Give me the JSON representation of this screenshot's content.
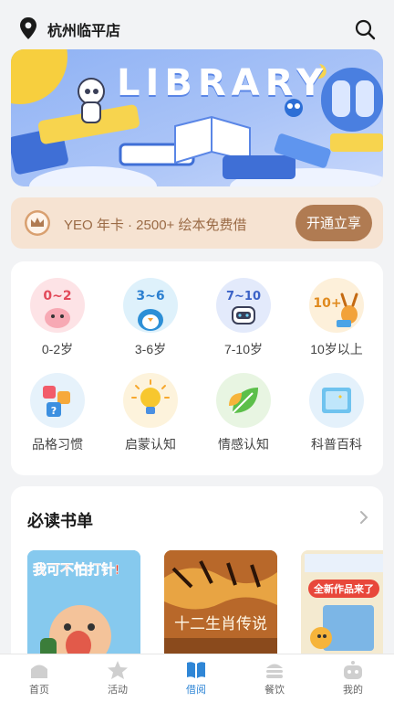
{
  "header": {
    "store_name": "杭州临平店"
  },
  "banner": {
    "title": "LIBRARY"
  },
  "vip": {
    "text": "YEO 年卡 · 2500+ 绘本免费借",
    "button": "开通立享"
  },
  "categories": [
    {
      "label": "0-2岁",
      "badge": "0~2",
      "color": "#fde3e6"
    },
    {
      "label": "3-6岁",
      "badge": "3~6",
      "color": "#def1fb"
    },
    {
      "label": "7-10岁",
      "badge": "7~10",
      "color": "#e3eafb"
    },
    {
      "label": "10岁以上",
      "badge": "10+",
      "color": "#fdf0da"
    },
    {
      "label": "品格习惯",
      "icon": "puzzle-icon",
      "color": "#e6f2fb"
    },
    {
      "label": "启蒙认知",
      "icon": "lightbulb-icon",
      "color": "#fdf3dc"
    },
    {
      "label": "情感认知",
      "icon": "leaf-icon",
      "color": "#e8f5e2"
    },
    {
      "label": "科普百科",
      "icon": "book-icon",
      "color": "#e4f1fb"
    }
  ],
  "reading_list": {
    "title": "必读书单",
    "books": [
      {
        "title": "我可不怕打针!",
        "color": "#7fc4ea"
      },
      {
        "title": "十二生肖传说",
        "color": "#c0722c"
      },
      {
        "title": "全新作品来了",
        "color": "#f2e6c8"
      }
    ]
  },
  "tabs": [
    {
      "label": "首页",
      "icon": "home-icon"
    },
    {
      "label": "活动",
      "icon": "star-icon"
    },
    {
      "label": "借阅",
      "icon": "book-icon",
      "active": true
    },
    {
      "label": "餐饮",
      "icon": "burger-icon"
    },
    {
      "label": "我的",
      "icon": "robot-icon"
    }
  ],
  "colors": {
    "accent": "#2f86d6",
    "vip_button": "#b07b52",
    "vip_bg": "#f6e3d2"
  }
}
